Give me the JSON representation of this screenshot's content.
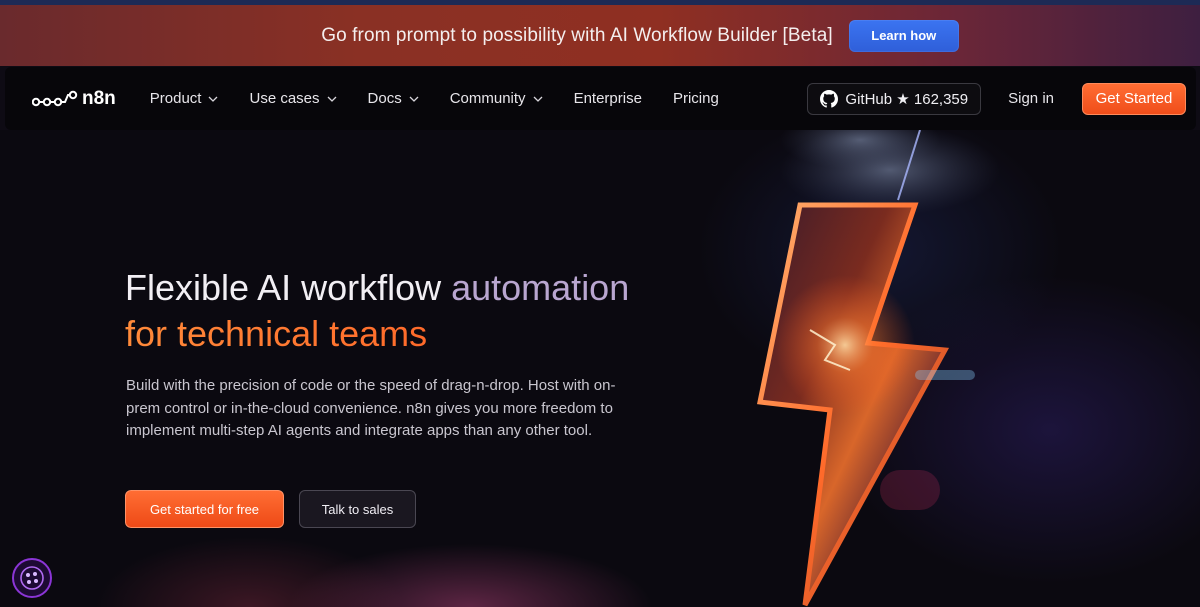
{
  "banner": {
    "text": "Go from prompt to possibility with AI Workflow Builder [Beta]",
    "button_label": "Learn how"
  },
  "nav": {
    "logo_text": "n8n",
    "items": [
      {
        "label": "Product",
        "has_dropdown": true
      },
      {
        "label": "Use cases",
        "has_dropdown": true
      },
      {
        "label": "Docs",
        "has_dropdown": true
      },
      {
        "label": "Community",
        "has_dropdown": true
      },
      {
        "label": "Enterprise",
        "has_dropdown": false
      },
      {
        "label": "Pricing",
        "has_dropdown": false
      }
    ],
    "github_label": "GitHub ★ 162,359",
    "signin_label": "Sign in",
    "get_started_label": "Get Started"
  },
  "hero": {
    "title_white": "Flexible AI workflow ",
    "title_purple": "automation",
    "title_orange": "for technical teams",
    "description": "Build with the precision of code or the speed of drag-n-drop. Host with on-prem control or in-the-cloud convenience. n8n gives you more freedom to implement multi-step AI agents and integrate apps than any other tool.",
    "cta_primary": "Get started for free",
    "cta_secondary": "Talk to sales"
  },
  "colors": {
    "accent_orange": "#ff6d33",
    "banner_button_blue": "#3b74f1",
    "title_purple": "#b9a6d0",
    "chat_badge_purple": "#8b35d6"
  },
  "icons": {
    "logo": "n8n-logo-icon",
    "github": "github-icon",
    "chevron": "chevron-down-icon",
    "chat": "chat-widget-icon"
  }
}
